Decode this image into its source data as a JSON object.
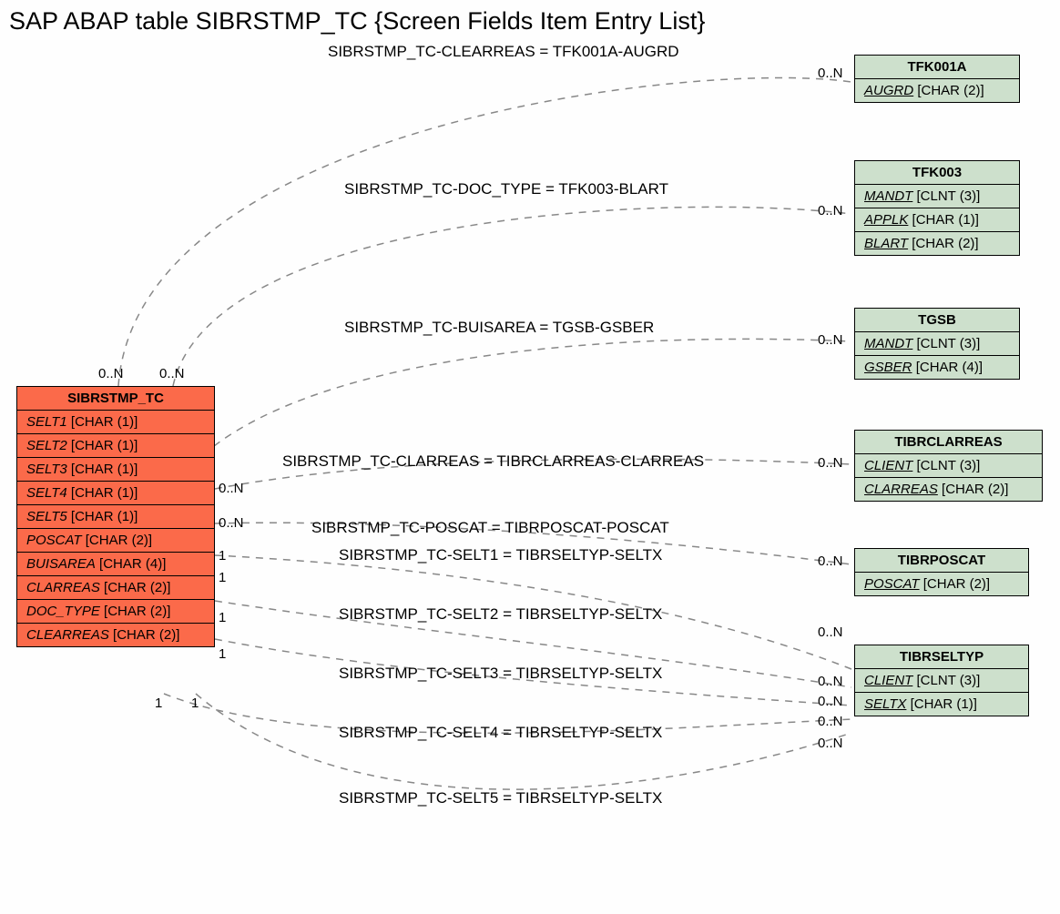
{
  "title": "SAP ABAP table SIBRSTMP_TC {Screen Fields Item Entry List}",
  "mainEntity": {
    "name": "SIBRSTMP_TC",
    "fields": [
      {
        "name": "SELT1",
        "type": "[CHAR (1)]"
      },
      {
        "name": "SELT2",
        "type": "[CHAR (1)]"
      },
      {
        "name": "SELT3",
        "type": "[CHAR (1)]"
      },
      {
        "name": "SELT4",
        "type": "[CHAR (1)]"
      },
      {
        "name": "SELT5",
        "type": "[CHAR (1)]"
      },
      {
        "name": "POSCAT",
        "type": "[CHAR (2)]"
      },
      {
        "name": "BUISAREA",
        "type": "[CHAR (4)]"
      },
      {
        "name": "CLARREAS",
        "type": "[CHAR (2)]"
      },
      {
        "name": "DOC_TYPE",
        "type": "[CHAR (2)]"
      },
      {
        "name": "CLEARREAS",
        "type": "[CHAR (2)]"
      }
    ]
  },
  "refs": {
    "TFK001A": {
      "name": "TFK001A",
      "fields": [
        {
          "name": "AUGRD",
          "type": "[CHAR (2)]",
          "u": true
        }
      ]
    },
    "TFK003": {
      "name": "TFK003",
      "fields": [
        {
          "name": "MANDT",
          "type": "[CLNT (3)]",
          "u": true
        },
        {
          "name": "APPLK",
          "type": "[CHAR (1)]",
          "u": true
        },
        {
          "name": "BLART",
          "type": "[CHAR (2)]",
          "u": true
        }
      ]
    },
    "TGSB": {
      "name": "TGSB",
      "fields": [
        {
          "name": "MANDT",
          "type": "[CLNT (3)]",
          "u": true
        },
        {
          "name": "GSBER",
          "type": "[CHAR (4)]",
          "u": true
        }
      ]
    },
    "TIBRCLARREAS": {
      "name": "TIBRCLARREAS",
      "fields": [
        {
          "name": "CLIENT",
          "type": "[CLNT (3)]",
          "u": true
        },
        {
          "name": "CLARREAS",
          "type": "[CHAR (2)]",
          "u": true
        }
      ]
    },
    "TIBRPOSCAT": {
      "name": "TIBRPOSCAT",
      "fields": [
        {
          "name": "POSCAT",
          "type": "[CHAR (2)]",
          "u": true
        }
      ]
    },
    "TIBRSELTYP": {
      "name": "TIBRSELTYP",
      "fields": [
        {
          "name": "CLIENT",
          "type": "[CLNT (3)]",
          "u": true
        },
        {
          "name": "SELTX",
          "type": "[CHAR (1)]",
          "u": true
        }
      ]
    }
  },
  "relLabels": {
    "r1": "SIBRSTMP_TC-CLEARREAS = TFK001A-AUGRD",
    "r2": "SIBRSTMP_TC-DOC_TYPE = TFK003-BLART",
    "r3": "SIBRSTMP_TC-BUISAREA = TGSB-GSBER",
    "r4": "SIBRSTMP_TC-CLARREAS = TIBRCLARREAS-CLARREAS",
    "r5": "SIBRSTMP_TC-POSCAT = TIBRPOSCAT-POSCAT",
    "r6": "SIBRSTMP_TC-SELT1 = TIBRSELTYP-SELTX",
    "r7": "SIBRSTMP_TC-SELT2 = TIBRSELTYP-SELTX",
    "r8": "SIBRSTMP_TC-SELT3 = TIBRSELTYP-SELTX",
    "r9": "SIBRSTMP_TC-SELT4 = TIBRSELTYP-SELTX",
    "r10": "SIBRSTMP_TC-SELT5 = TIBRSELTYP-SELTX"
  },
  "cards": {
    "leftTop1": "0..N",
    "leftTop2": "0..N",
    "left_r4": "0..N",
    "left_r5": "0..N",
    "left_r6": "1",
    "left_r7": "1",
    "left_r8": "1",
    "left_r9": "1",
    "leftBot1": "1",
    "leftBot2": "1",
    "right_r1": "0..N",
    "right_r2": "0..N",
    "right_r3": "0..N",
    "right_r4": "0..N",
    "right_r5": "0..N",
    "right_r6": "0..N",
    "right_r7": "0..N",
    "right_r8": "0..N",
    "right_r9": "0..N",
    "right_r10": "0..N"
  }
}
